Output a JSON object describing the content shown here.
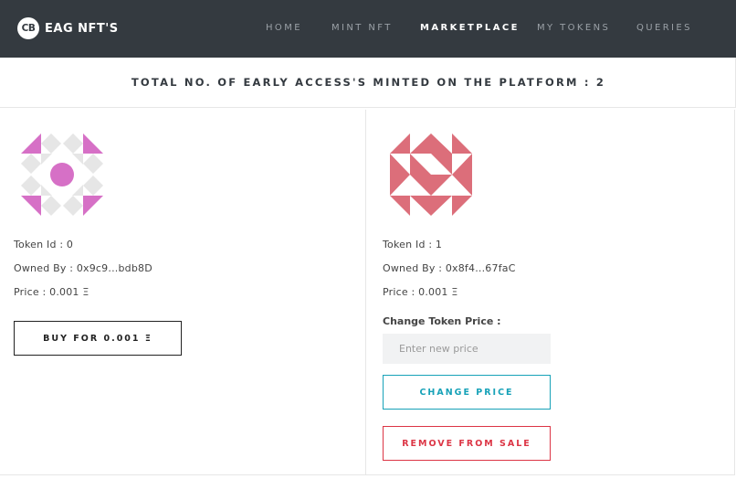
{
  "navbar": {
    "logo_text": "CB",
    "brand_name": "EAG NFT'S",
    "links": [
      {
        "label": "HOME",
        "active": false
      },
      {
        "label": "MINT NFT",
        "active": false
      },
      {
        "label": "MARKETPLACE",
        "active": true
      },
      {
        "label": "MY TOKENS",
        "active": false
      },
      {
        "label": "QUERIES",
        "active": false
      }
    ]
  },
  "summary": {
    "total_text": "TOTAL NO. OF EARLY ACCESS'S MINTED ON THE PLATFORM : 2"
  },
  "tokens": [
    {
      "identicon_color": "#d670c6",
      "identicon_secondary": "#e6e6e6",
      "token_id_text": "Token Id : 0",
      "owned_by_text": "Owned By : 0x9c9...bdb8D",
      "price_text": "Price : 0.001 Ξ",
      "buy_label": "BUY FOR 0.001 Ξ"
    },
    {
      "identicon_color": "#dc6e7a",
      "token_id_text": "Token Id : 1",
      "owned_by_text": "Owned By : 0x8f4...67faC",
      "price_text": "Price : 0.001 Ξ",
      "change_price_label": "Change Token Price :",
      "new_price_placeholder": "Enter new price",
      "change_price_button": "CHANGE PRICE",
      "remove_button": "REMOVE FROM SALE"
    }
  ],
  "colors": {
    "navbar_bg": "#343a40",
    "change_btn": "#17a2b8",
    "remove_btn": "#dc3545"
  }
}
